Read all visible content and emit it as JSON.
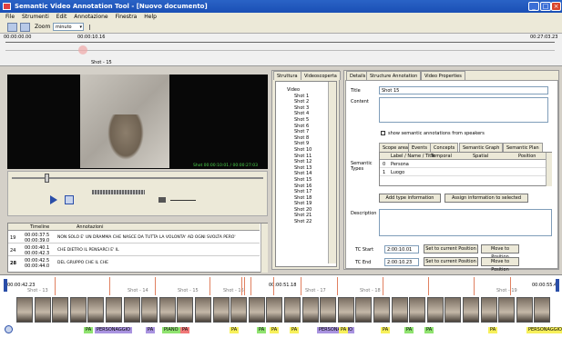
{
  "window": {
    "title": "Semantic Video Annotation Tool - [Nuovo documento]"
  },
  "menu": [
    "File",
    "Strumenti",
    "Edit",
    "Annotazione",
    "Finestra",
    "Help"
  ],
  "toolbar": {
    "zoom_label": "Zoom",
    "zoom_value": "minuto"
  },
  "timeline_top": {
    "start": "00:00:00.00",
    "mark": "00:00:10.16",
    "end": "00:27:03.23",
    "shot_label": "Shot - 15"
  },
  "player": {
    "timecode": "Shot 00:00:10:01 / 00:00:27:03"
  },
  "annotations_table": {
    "headers": [
      "",
      "Timeline",
      "Annotazioni"
    ],
    "rows": [
      {
        "num": "19",
        "time1": "00:00:37.5",
        "time2": "00:00:39.0",
        "text": "NON SOLO E' UN DRAMMA CHE NASCE DA TUTTA LA VOLONTA' AD OGNI SVOLTA PERO'"
      },
      {
        "num": "24",
        "time1": "00:00:40.1",
        "time2": "00:00:42.3",
        "text": "CHE DIETRO IL PENSARCI E' IL"
      },
      {
        "num": "28",
        "time1": "00:00:42.5",
        "time2": "00:00:44.0",
        "text": "DEL GRUPPO CHE IL CHE"
      }
    ]
  },
  "tree": {
    "tabs": [
      "Struttura",
      "Videoscoperta"
    ],
    "root": "Video",
    "items": [
      "Shot 1",
      "Shot 2",
      "Shot 3",
      "Shot 4",
      "Shot 5",
      "Shot 6",
      "Shot 7",
      "Shot 8",
      "Shot 9",
      "Shot 10",
      "Shot 11",
      "Shot 12",
      "Shot 13",
      "Shot 14",
      "Shot 15",
      "Shot 16",
      "Shot 17",
      "Shot 18",
      "Shot 19",
      "Shot 20",
      "Shot 21",
      "Shot 22"
    ]
  },
  "details": {
    "tabs": [
      "Details",
      "Structure Annotation",
      "Video Properties"
    ],
    "title_label": "Title",
    "title_value": "Shot 15",
    "content_label": "Content",
    "checkbox_label": "show semantic annotations from speakers",
    "subtabs": [
      "Scope area",
      "Events",
      "Concepts",
      "Semantic Graph",
      "Semantic Plan"
    ],
    "semantic_label": "Semantic Types",
    "table_headers": [
      "",
      "Label / Name / Title",
      "Temporal",
      "Spatial",
      "Position"
    ],
    "table_rows": [
      {
        "num": "0",
        "label": "Persona"
      },
      {
        "num": "1",
        "label": "Luogo"
      }
    ],
    "btn_add": "Add type information",
    "btn_assign": "Assign information to selected",
    "description_label": "Description",
    "tc_start_label": "TC Start",
    "tc_start_value": "2:00:10.01",
    "tc_end_label": "TC End",
    "tc_end_value": "2:00:10.23",
    "btn_set_current_1": "Set to current Position",
    "btn_go_position_1": "Move to Position",
    "btn_set_current_2": "Set to current Position",
    "btn_go_position_2": "Move to Position"
  },
  "bottom_timeline": {
    "start": "00:00:42.23",
    "mid": "00:00:51.18",
    "end": "00:00:55.41",
    "shot_labels": [
      "Shot - 13",
      "Shot - 14",
      "Shot - 15",
      "Shot - 16",
      "Shot - 17",
      "Shot - 18",
      "Shot - 19"
    ],
    "tags": [
      "PA",
      "PERSONAGGIO",
      "PA",
      "PIANO",
      "PA",
      "PA",
      "PA",
      "PA",
      "PA",
      "PERSONAGGIO",
      "PA",
      "PA",
      "PA",
      "PA",
      "PA",
      "PERSONAGGIO"
    ]
  },
  "colors": {
    "accent": "#1a4fb5",
    "tag_green": "#8fe36f",
    "tag_yellow": "#f7f05b",
    "tag_purple": "#a993e0",
    "tag_red": "#f07878"
  }
}
